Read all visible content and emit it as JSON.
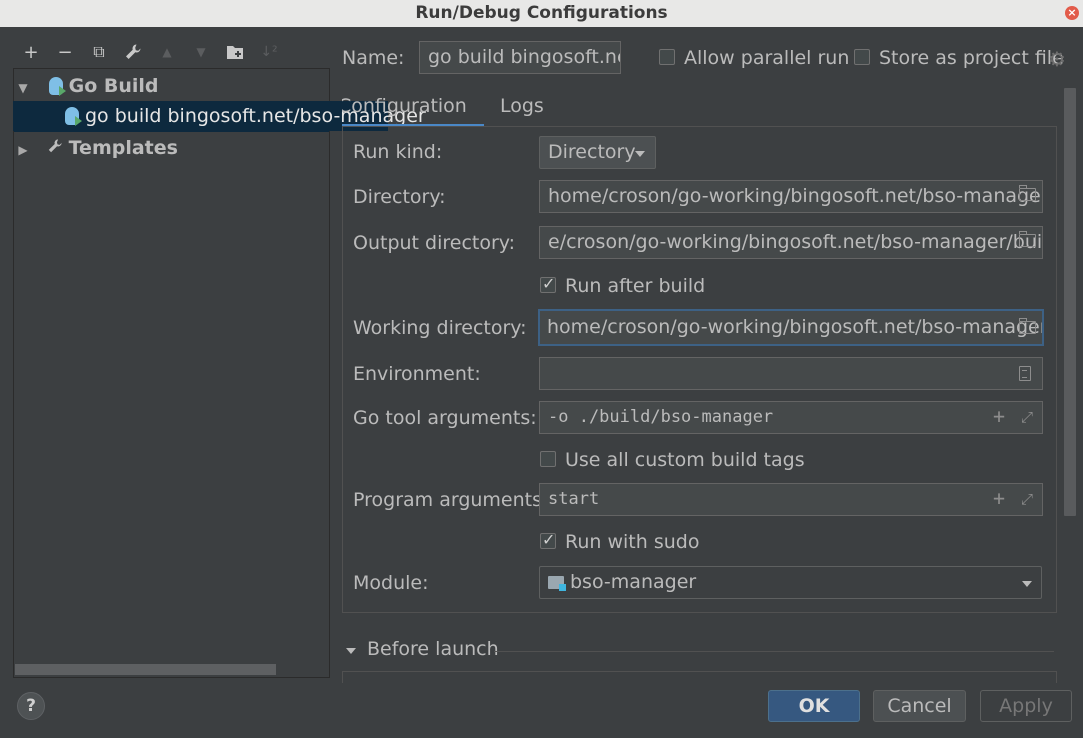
{
  "window": {
    "title": "Run/Debug Configurations",
    "close_glyph": "×"
  },
  "toolbar": {
    "add_glyph": "+",
    "remove_glyph": "−",
    "copy_glyph": "⧉",
    "edit_glyph": "🔧",
    "up_glyph": "▲",
    "down_glyph": "▼",
    "folder_glyph": "▙",
    "sort_glyph": "↓²"
  },
  "tree": {
    "group_label": "Go Build",
    "item_label": "go build bingosoft.net/bso-manager",
    "templates_label": "Templates"
  },
  "header": {
    "name_label": "Name:",
    "name_value": "go build bingosoft.net",
    "allow_parallel_label": "Allow parallel run",
    "store_project_label": "Store as project file"
  },
  "tabs": [
    {
      "label": "Configuration"
    },
    {
      "label": "Logs"
    }
  ],
  "form": {
    "run_kind_label": "Run kind:",
    "run_kind_value": "Directory",
    "directory_label": "Directory:",
    "directory_value": "home/croson/go-working/bingosoft.net/bso-manager/",
    "output_dir_label": "Output directory:",
    "output_dir_value": "e/croson/go-working/bingosoft.net/bso-manager/build",
    "run_after_build_label": "Run after build",
    "run_after_build": true,
    "working_dir_label": "Working directory:",
    "working_dir_value": "home/croson/go-working/bingosoft.net/bso-manager/",
    "environment_label": "Environment:",
    "environment_value": "",
    "go_tool_args_label": "Go tool arguments:",
    "go_tool_args_value": "-o ./build/bso-manager",
    "custom_tags_label": "Use all custom build tags",
    "custom_tags": false,
    "program_args_label": "Program arguments:",
    "program_args_value": "start",
    "run_with_sudo_label": "Run with sudo",
    "run_with_sudo": true,
    "module_label": "Module:",
    "module_value": "bso-manager"
  },
  "before_launch": {
    "label": "Before launch"
  },
  "buttons": {
    "ok": "OK",
    "cancel": "Cancel",
    "apply": "Apply",
    "help": "?"
  },
  "colors": {
    "accent": "#4a88c7",
    "primary_button": "#365880",
    "selection": "#0d293e",
    "background": "#3c3f41"
  }
}
